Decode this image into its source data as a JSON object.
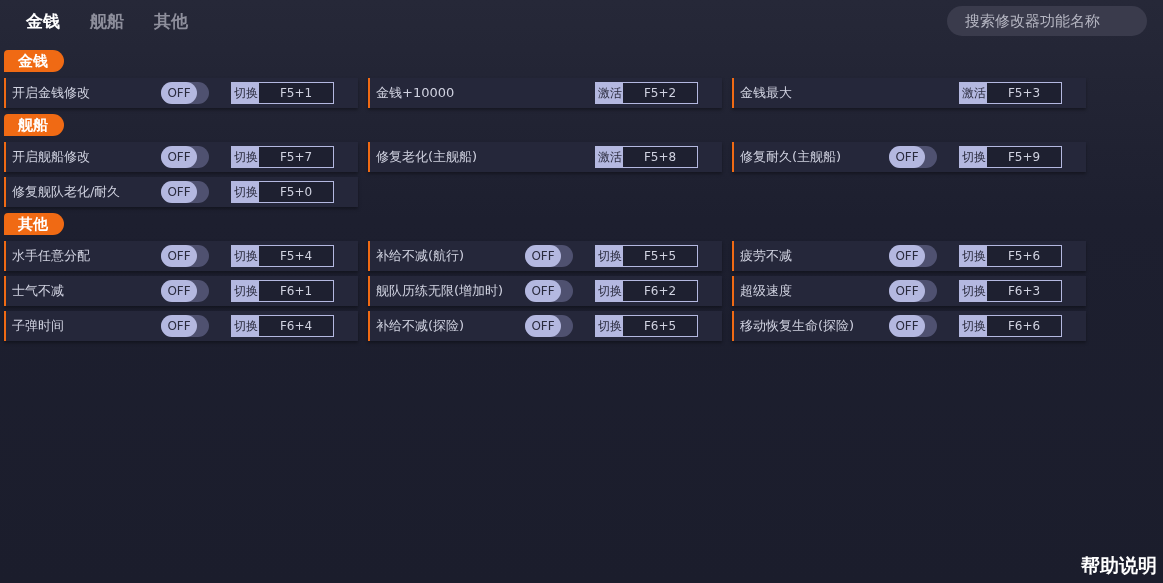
{
  "tabs": [
    {
      "label": "金钱",
      "selected": true
    },
    {
      "label": "舰船",
      "selected": false
    },
    {
      "label": "其他",
      "selected": false
    }
  ],
  "search": {
    "placeholder": "搜索修改器功能名称"
  },
  "sections": [
    {
      "title": "金钱",
      "items": [
        {
          "kind": "toggle",
          "label": "开启金钱修改",
          "on": false,
          "switch_text": "OFF",
          "key_action": "切换",
          "hotkey": "F5+1"
        },
        {
          "kind": "button",
          "label": "金钱+10000",
          "key_action": "激活",
          "hotkey": "F5+2"
        },
        {
          "kind": "button",
          "label": "金钱最大",
          "key_action": "激活",
          "hotkey": "F5+3"
        }
      ]
    },
    {
      "title": "舰船",
      "items": [
        {
          "kind": "toggle",
          "label": "开启舰船修改",
          "on": false,
          "switch_text": "OFF",
          "key_action": "切换",
          "hotkey": "F5+7"
        },
        {
          "kind": "button",
          "label": "修复老化(主舰船)",
          "key_action": "激活",
          "hotkey": "F5+8"
        },
        {
          "kind": "toggle",
          "label": "修复耐久(主舰船)",
          "on": false,
          "switch_text": "OFF",
          "key_action": "切换",
          "hotkey": "F5+9"
        },
        {
          "kind": "toggle",
          "label": "修复舰队老化/耐久",
          "on": false,
          "switch_text": "OFF",
          "key_action": "切换",
          "hotkey": "F5+0"
        }
      ]
    },
    {
      "title": "其他",
      "items": [
        {
          "kind": "toggle",
          "label": "水手任意分配",
          "on": false,
          "switch_text": "OFF",
          "key_action": "切换",
          "hotkey": "F5+4"
        },
        {
          "kind": "toggle",
          "label": "补给不减(航行)",
          "on": false,
          "switch_text": "OFF",
          "key_action": "切换",
          "hotkey": "F5+5"
        },
        {
          "kind": "toggle",
          "label": "疲劳不减",
          "on": false,
          "switch_text": "OFF",
          "key_action": "切换",
          "hotkey": "F5+6"
        },
        {
          "kind": "toggle",
          "label": "士气不减",
          "on": false,
          "switch_text": "OFF",
          "key_action": "切换",
          "hotkey": "F6+1"
        },
        {
          "kind": "toggle",
          "label": "舰队历练无限(增加时)",
          "on": false,
          "switch_text": "OFF",
          "key_action": "切换",
          "hotkey": "F6+2"
        },
        {
          "kind": "toggle",
          "label": "超级速度",
          "on": false,
          "switch_text": "OFF",
          "key_action": "切换",
          "hotkey": "F6+3"
        },
        {
          "kind": "toggle",
          "label": "子弹时间",
          "on": false,
          "switch_text": "OFF",
          "key_action": "切换",
          "hotkey": "F6+4"
        },
        {
          "kind": "toggle",
          "label": "补给不减(探险)",
          "on": false,
          "switch_text": "OFF",
          "key_action": "切换",
          "hotkey": "F6+5"
        },
        {
          "kind": "toggle",
          "label": "移动恢复生命(探险)",
          "on": false,
          "switch_text": "OFF",
          "key_action": "切换",
          "hotkey": "F6+6"
        }
      ]
    }
  ],
  "help_link": "帮助说明"
}
